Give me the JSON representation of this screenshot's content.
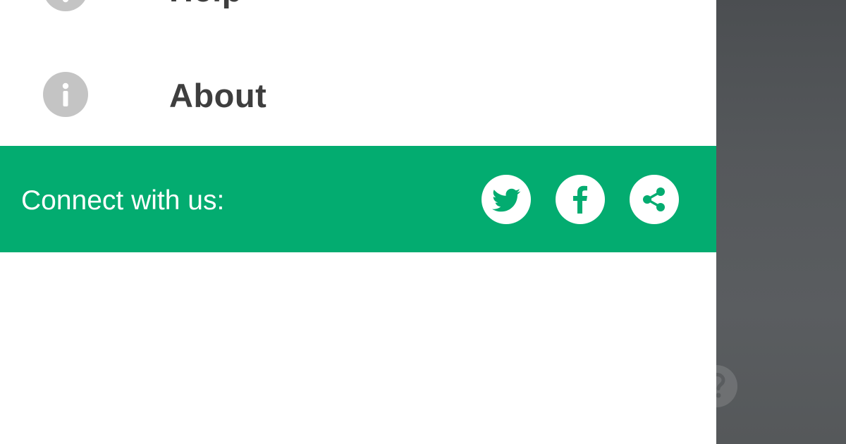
{
  "menu": {
    "items": [
      {
        "label": "Help",
        "icon": "help-icon"
      },
      {
        "label": "About",
        "icon": "info-icon"
      }
    ]
  },
  "connect": {
    "label": "Connect with us:",
    "buttons": [
      {
        "name": "twitter",
        "icon": "twitter-icon"
      },
      {
        "name": "facebook",
        "icon": "facebook-icon"
      },
      {
        "name": "share",
        "icon": "share-icon"
      }
    ]
  },
  "colors": {
    "accent_green": "#03ac70",
    "icon_gray": "#c4c4c4",
    "label_dark": "#3e3e3e",
    "backdrop": "#55585b"
  }
}
